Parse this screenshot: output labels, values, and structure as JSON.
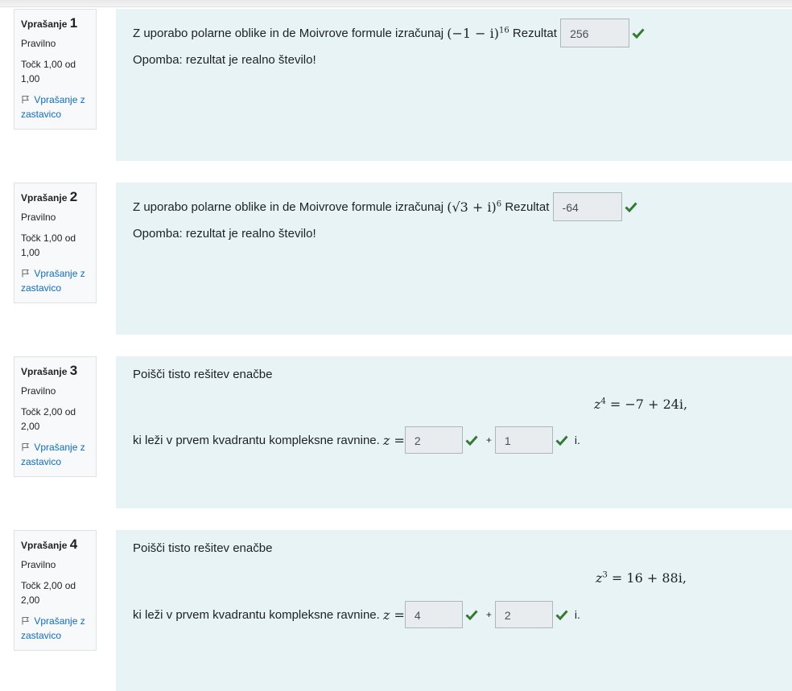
{
  "questions": [
    {
      "label": "Vprašanje",
      "number": "1",
      "state": "Pravilno",
      "grade_line1": "Točk 1,00 od",
      "grade_line2": "1,00",
      "flag_line1": "Vprašanje z",
      "flag_line2": "zastavico",
      "text_before": "Z uporabo polarne oblike in de Moivrove formule izračunaj",
      "math_base": "(−1 − i)",
      "math_exp": "16",
      "result_label": "Rezultat",
      "answer": "256",
      "note": "Opomba: rezultat je realno število!"
    },
    {
      "label": "Vprašanje",
      "number": "2",
      "state": "Pravilno",
      "grade_line1": "Točk 1,00 od",
      "grade_line2": "1,00",
      "flag_line1": "Vprašanje z",
      "flag_line2": "zastavico",
      "text_before": "Z uporabo polarne oblike in de Moivrove formule izračunaj",
      "math_base": "(√3 + i)",
      "math_exp": "6",
      "result_label": "Rezultat",
      "answer": "-64",
      "note": "Opomba: rezultat je realno število!"
    },
    {
      "label": "Vprašanje",
      "number": "3",
      "state": "Pravilno",
      "grade_line1": "Točk 2,00 od",
      "grade_line2": "2,00",
      "flag_line1": "Vprašanje z",
      "flag_line2": "zastavico",
      "intro": "Poišči tisto rešitev enačbe",
      "equation_lhs": "z",
      "equation_exp": "4",
      "equation_rhs": "= −7 + 24i,",
      "text_after": "ki leži v prvem kvadrantu kompleksne ravnine.",
      "z_label": "z =",
      "answer_real": "2",
      "plus": "+",
      "answer_imag": "1",
      "imag_unit": "i."
    },
    {
      "label": "Vprašanje",
      "number": "4",
      "state": "Pravilno",
      "grade_line1": "Točk 2,00 od",
      "grade_line2": "2,00",
      "flag_line1": "Vprašanje z",
      "flag_line2": "zastavico",
      "intro": "Poišči tisto rešitev enačbe",
      "equation_lhs": "z",
      "equation_exp": "3",
      "equation_rhs": "= 16 + 88i,",
      "text_after": "ki leži v prvem kvadrantu kompleksne ravnine.",
      "z_label": "z =",
      "answer_real": "4",
      "plus": "+",
      "answer_imag": "2",
      "imag_unit": "i."
    }
  ],
  "colors": {
    "correct": "#357a32",
    "link": "#0f6cbf",
    "content_bg": "#e7f3f5",
    "info_bg": "#f8f9fa"
  }
}
